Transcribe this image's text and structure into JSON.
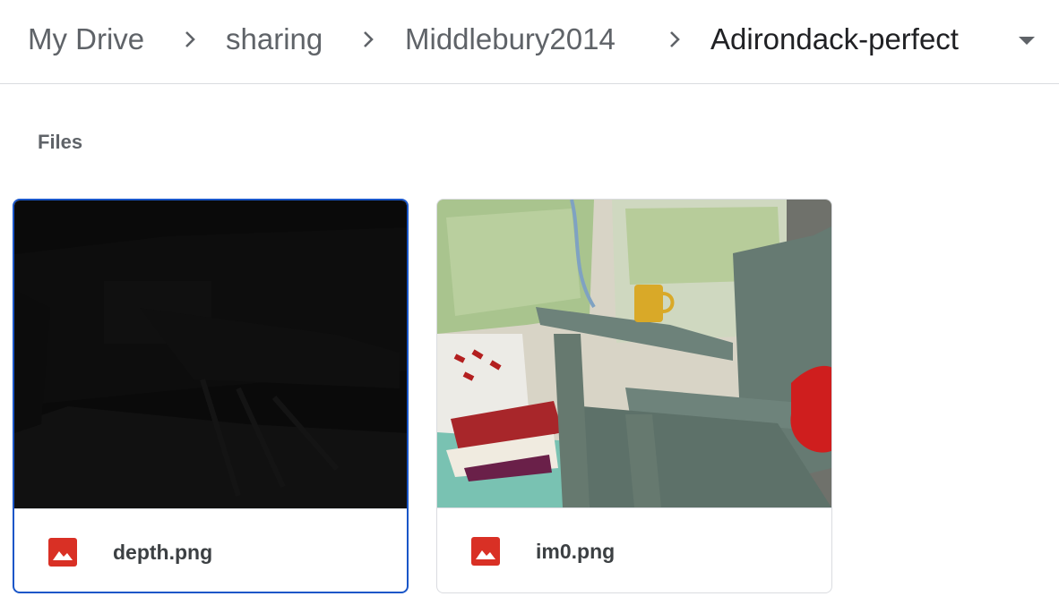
{
  "breadcrumb": {
    "items": [
      {
        "label": "My Drive"
      },
      {
        "label": "sharing"
      },
      {
        "label": "Middlebury2014"
      },
      {
        "label": "Adirondack-perfect"
      }
    ],
    "separator_icon": "chevron-right-icon",
    "dropdown_icon": "arrow-drop-down-icon"
  },
  "files_section": {
    "title": "Files",
    "files": [
      {
        "name": "depth.png",
        "icon": "image-file-icon",
        "selected": true
      },
      {
        "name": "im0.png",
        "icon": "image-file-icon",
        "selected": false
      }
    ]
  },
  "colors": {
    "selected_border": "#1a56c8",
    "image_icon": "#d93025",
    "text_primary": "#202124",
    "text_secondary": "#5f6368"
  }
}
